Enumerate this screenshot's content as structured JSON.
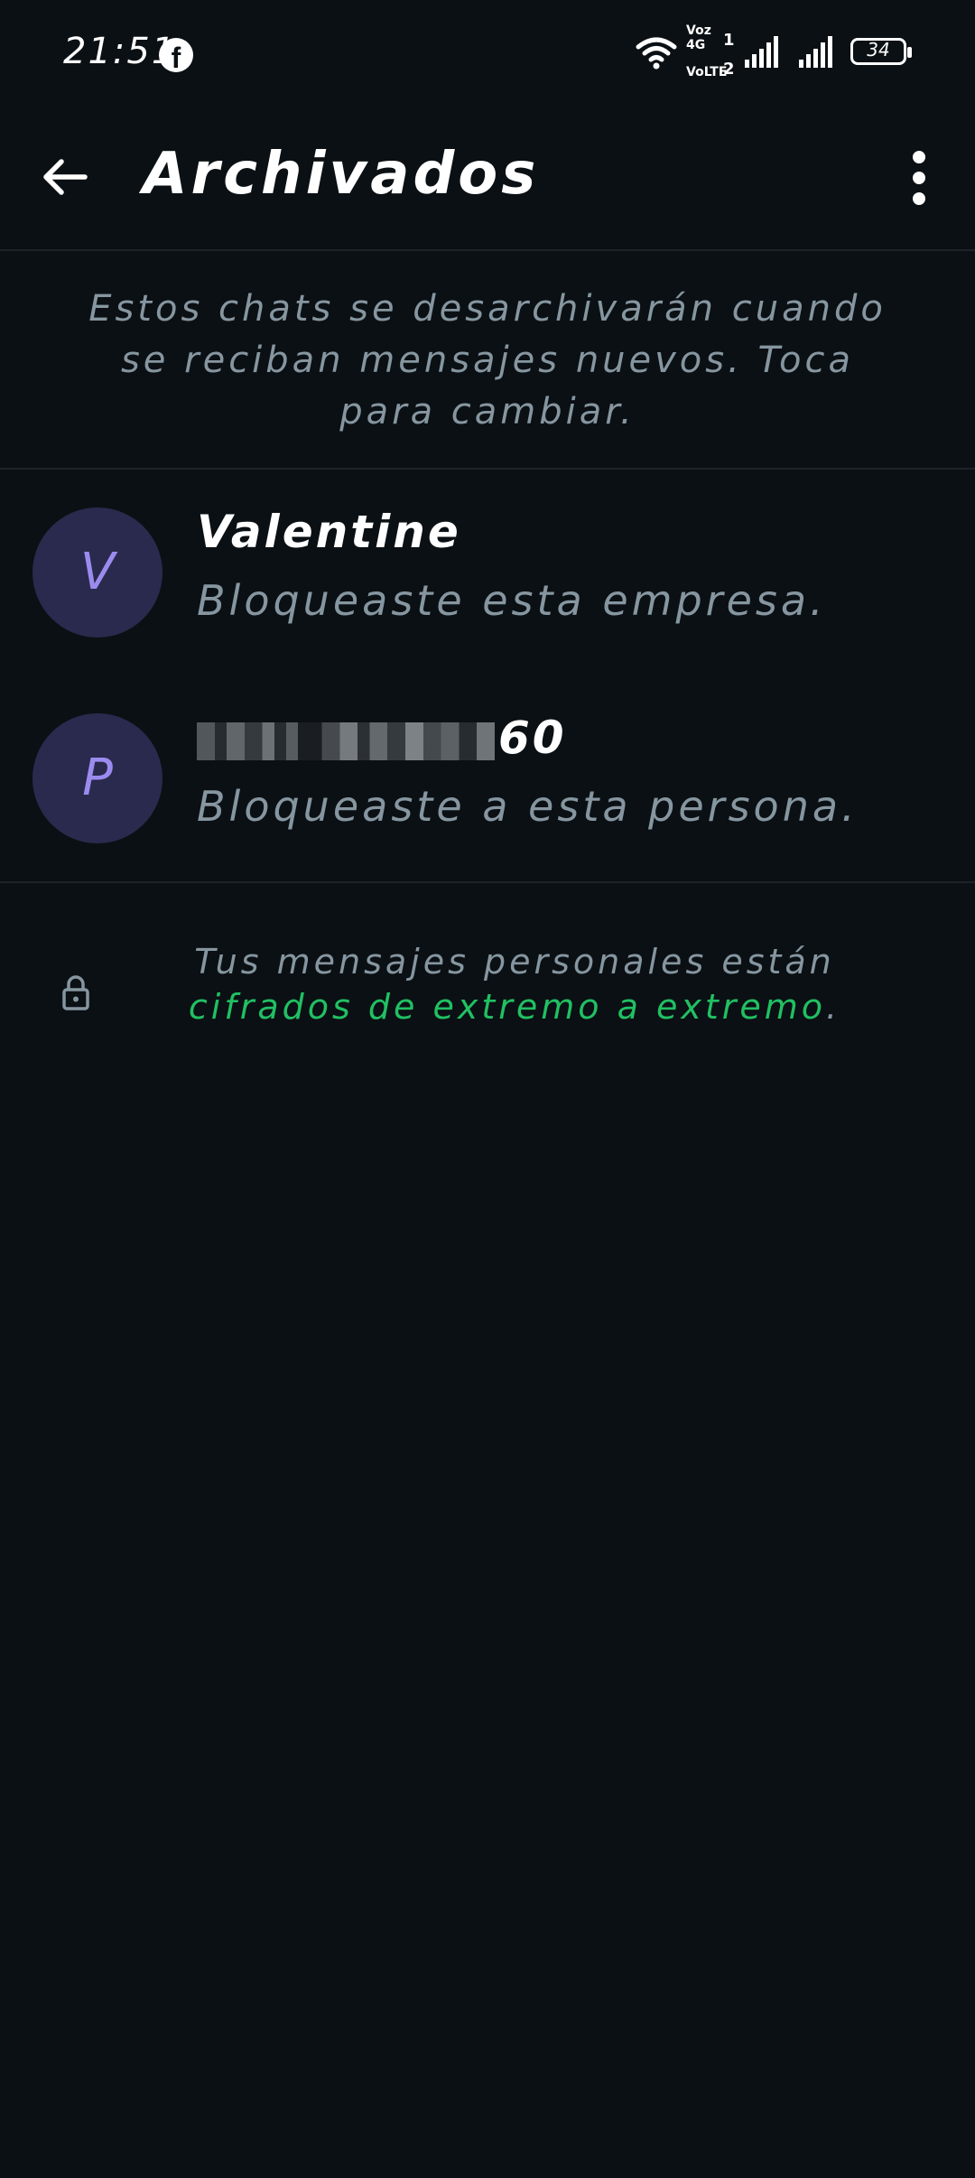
{
  "status_bar": {
    "time": "21:51",
    "battery": "34",
    "network_top": "Voz 4G",
    "network_bottom": "VoLTE",
    "sim1": "1",
    "sim2": "2"
  },
  "header": {
    "title": "Archivados"
  },
  "info_banner": {
    "text": "Estos chats se desarchivarán cuando se reciban mensajes nuevos. Toca para cambiar."
  },
  "chats": [
    {
      "initial": "V",
      "name": "Valentine",
      "preview": "Bloqueaste esta empresa."
    },
    {
      "initial": "P",
      "name_suffix": "60",
      "preview": "Bloqueaste a esta persona."
    }
  ],
  "encryption": {
    "text_before": "Tus mensajes personales están ",
    "link": "cifrados de extremo a extremo",
    "text_after": "."
  },
  "colors": {
    "background": "#0b1014",
    "accent_green": "#21c063",
    "avatar_bg": "#2a2a4e",
    "avatar_letter": "#9b8bef",
    "secondary_text": "#8696a0"
  },
  "icons": {
    "back": "arrow-left",
    "more": "vertical-dots",
    "lock": "padlock",
    "notification": "facebook"
  }
}
